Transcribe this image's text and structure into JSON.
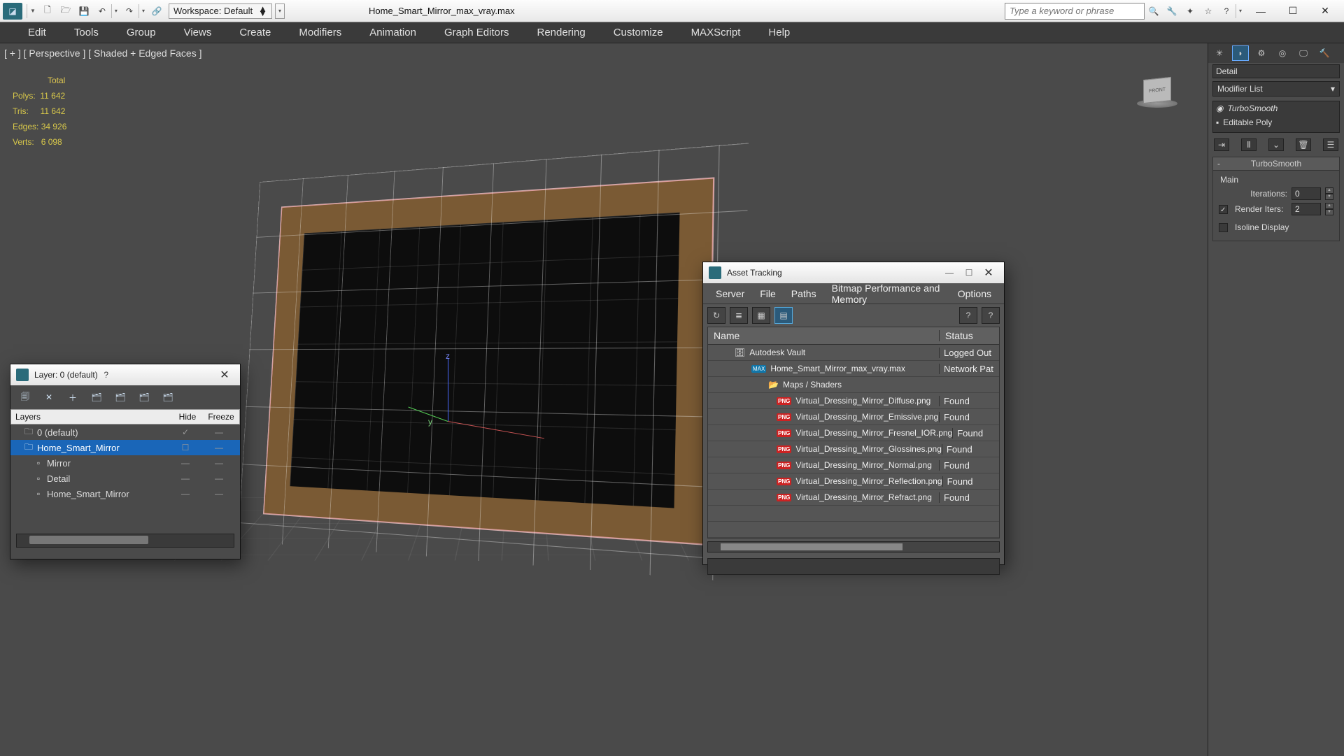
{
  "title_bar": {
    "workspace_label": "Workspace: Default",
    "file_title": "Home_Smart_Mirror_max_vray.max",
    "search_placeholder": "Type a keyword or phrase"
  },
  "menu": [
    "Edit",
    "Tools",
    "Group",
    "Views",
    "Create",
    "Modifiers",
    "Animation",
    "Graph Editors",
    "Rendering",
    "Customize",
    "MAXScript",
    "Help"
  ],
  "viewport": {
    "label": "[ + ] [ Perspective ] [ Shaded + Edged Faces ]",
    "stats_header": "Total",
    "stats": {
      "polys_label": "Polys:",
      "polys_value": "11 642",
      "tris_label": "Tris:",
      "tris_value": "11 642",
      "edges_label": "Edges:",
      "edges_value": "34 926",
      "verts_label": "Verts:",
      "verts_value": "6 098"
    },
    "axes": {
      "x": "x",
      "y": "y",
      "z": "z"
    }
  },
  "command_panel": {
    "name_field": "Detail",
    "modifier_list_label": "Modifier List",
    "stack": {
      "turbosmooth": "TurboSmooth",
      "editable_poly": "Editable Poly"
    },
    "rollup": {
      "title": "TurboSmooth",
      "section_main": "Main",
      "iterations_label": "Iterations:",
      "iterations_value": "0",
      "render_iters_label": "Render Iters:",
      "render_iters_value": "2",
      "isoline_label": "Isoline Display"
    }
  },
  "layer_dialog": {
    "title": "Layer: 0 (default)",
    "columns": {
      "layers": "Layers",
      "hide": "Hide",
      "freeze": "Freeze"
    },
    "rows": [
      {
        "name": "0 (default)",
        "indent": 0,
        "icon": "layer",
        "hide": "check",
        "selected": false
      },
      {
        "name": "Home_Smart_Mirror",
        "indent": 0,
        "icon": "layer",
        "hide": "box",
        "selected": true
      },
      {
        "name": "Mirror",
        "indent": 1,
        "icon": "obj",
        "hide": "dash",
        "selected": false
      },
      {
        "name": "Detail",
        "indent": 1,
        "icon": "obj",
        "hide": "dash",
        "selected": false
      },
      {
        "name": "Home_Smart_Mirror",
        "indent": 1,
        "icon": "obj",
        "hide": "dash",
        "selected": false
      }
    ]
  },
  "asset_dialog": {
    "title": "Asset Tracking",
    "menu": [
      "Server",
      "File",
      "Paths",
      "Bitmap Performance and Memory",
      "Options"
    ],
    "columns": {
      "name": "Name",
      "status": "Status"
    },
    "rows": [
      {
        "indent": 1,
        "icon": "vault",
        "name": "Autodesk Vault",
        "status": "Logged Out"
      },
      {
        "indent": 2,
        "icon": "max",
        "name": "Home_Smart_Mirror_max_vray.max",
        "status": "Network Pat"
      },
      {
        "indent": 3,
        "icon": "folder",
        "name": "Maps / Shaders",
        "status": ""
      },
      {
        "indent": 4,
        "icon": "png",
        "name": "Virtual_Dressing_Mirror_Diffuse.png",
        "status": "Found"
      },
      {
        "indent": 4,
        "icon": "png",
        "name": "Virtual_Dressing_Mirror_Emissive.png",
        "status": "Found"
      },
      {
        "indent": 4,
        "icon": "png",
        "name": "Virtual_Dressing_Mirror_Fresnel_IOR.png",
        "status": "Found"
      },
      {
        "indent": 4,
        "icon": "png",
        "name": "Virtual_Dressing_Mirror_Glossines.png",
        "status": "Found"
      },
      {
        "indent": 4,
        "icon": "png",
        "name": "Virtual_Dressing_Mirror_Normal.png",
        "status": "Found"
      },
      {
        "indent": 4,
        "icon": "png",
        "name": "Virtual_Dressing_Mirror_Reflection.png",
        "status": "Found"
      },
      {
        "indent": 4,
        "icon": "png",
        "name": "Virtual_Dressing_Mirror_Refract.png",
        "status": "Found"
      }
    ]
  }
}
